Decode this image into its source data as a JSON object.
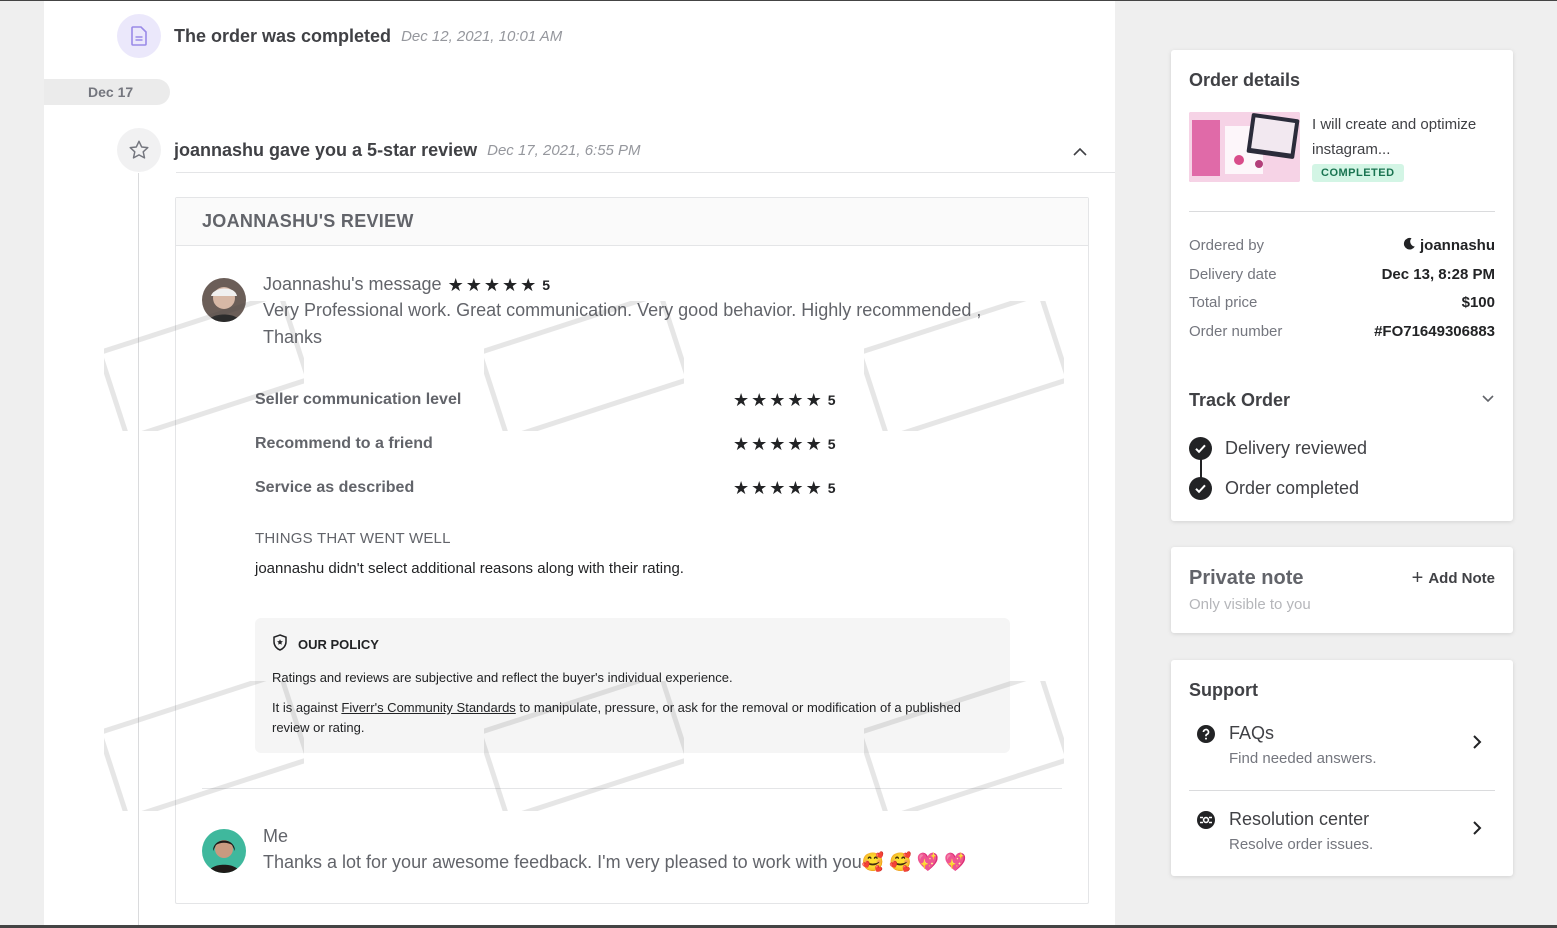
{
  "timeline": {
    "completed_event": {
      "title": "The order was completed",
      "date": "Dec 12, 2021, 10:01 AM"
    },
    "date_separator": "Dec 17",
    "review_event": {
      "title": "joannashu gave you a 5-star review",
      "date": "Dec 17, 2021, 6:55 PM"
    }
  },
  "review": {
    "header": "JOANNASHU'S REVIEW",
    "buyer_message": {
      "name": "Joannashu's message",
      "rating": "5",
      "text": "Very Professional work. Great communication. Very good behavior. Highly recommended , Thanks"
    },
    "ratings": [
      {
        "label": "Seller communication level",
        "score": "5"
      },
      {
        "label": "Recommend to a friend",
        "score": "5"
      },
      {
        "label": "Service as described",
        "score": "5"
      }
    ],
    "went_well_title": "THINGS THAT WENT WELL",
    "went_well_text": "joannashu didn't select additional reasons along with their rating.",
    "policy": {
      "title": "OUR POLICY",
      "line1": "Ratings and reviews are subjective and reflect the buyer's individual experience.",
      "line2_prefix": "It is against ",
      "line2_link": "Fiverr's Community Standards",
      "line2_suffix": " to manipulate, pressure, or ask for the removal or modification of a published review or rating."
    },
    "seller_reply": {
      "name": "Me",
      "text": "Thanks a lot for your awesome feedback. I'm very pleased to work with you🥰 🥰 💖 💖"
    }
  },
  "sidebar": {
    "order_details": {
      "title": "Order details",
      "gig_title": "I will create and optimize instagram...",
      "status": "COMPLETED",
      "rows": [
        {
          "label": "Ordered by",
          "value": "joannashu"
        },
        {
          "label": "Delivery date",
          "value": "Dec 13, 8:28 PM"
        },
        {
          "label": "Total price",
          "value": "$100"
        },
        {
          "label": "Order number",
          "value": "#FO71649306883"
        }
      ],
      "track_title": "Track Order",
      "track_steps": [
        "Delivery reviewed",
        "Order completed"
      ]
    },
    "private_note": {
      "title": "Private note",
      "subtitle": "Only visible to you",
      "add_label": "Add Note"
    },
    "support": {
      "title": "Support",
      "items": [
        {
          "label": "FAQs",
          "sub": "Find needed answers."
        },
        {
          "label": "Resolution center",
          "sub": "Resolve order issues."
        }
      ]
    }
  },
  "colors": {
    "text_dark": "#222325",
    "text_gray": "#62646a",
    "badge_bg": "#d3f5e5",
    "badge_text": "#1a7451",
    "doc_icon_bg": "#ebe8fb",
    "doc_icon": "#9a8ae8"
  },
  "icons": [
    "document-icon",
    "star-outline-icon",
    "chevron-up-icon",
    "shield-icon",
    "check-circle-icon",
    "chevron-down-icon",
    "plus-icon",
    "question-circle-icon",
    "lifebuoy-icon",
    "chevron-right-icon",
    "moon-icon"
  ]
}
